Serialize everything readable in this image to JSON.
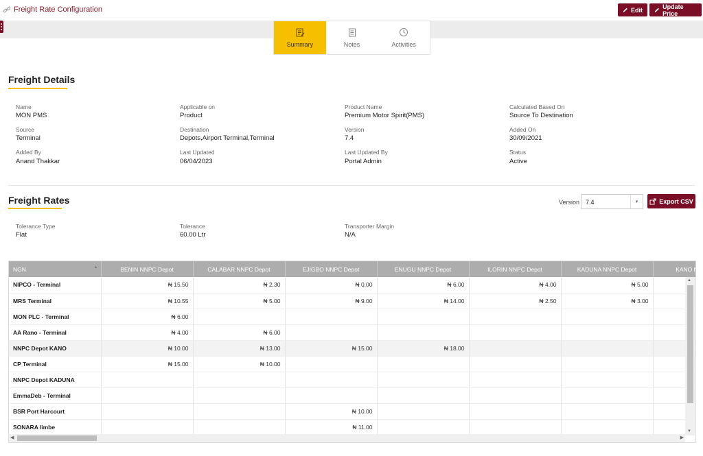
{
  "header": {
    "title": "Freight Rate Configuration",
    "edit_label": "Edit",
    "update_label": "Update Price"
  },
  "tabs": [
    {
      "label": "Summary",
      "icon": "summary-icon",
      "active": true
    },
    {
      "label": "Notes",
      "icon": "notes-icon",
      "active": false
    },
    {
      "label": "Activities",
      "icon": "activities-icon",
      "active": false
    }
  ],
  "freight_details": {
    "title": "Freight Details",
    "fields": [
      {
        "label": "Name",
        "value": "MON PMS"
      },
      {
        "label": "Applicable on",
        "value": "Product"
      },
      {
        "label": "Product Name",
        "value": "Premium Motor Spirit(PMS)"
      },
      {
        "label": "Calculated Based On",
        "value": "Source To Destination"
      },
      {
        "label": "Source",
        "value": "Terminal"
      },
      {
        "label": "Destination",
        "value": "Depots,Airport Terminal,Terminal"
      },
      {
        "label": "Version",
        "value": "7.4"
      },
      {
        "label": "Added On",
        "value": "30/09/2021"
      },
      {
        "label": "Added By",
        "value": "Anand Thakkar"
      },
      {
        "label": "Last Updated",
        "value": "06/04/2023"
      },
      {
        "label": "Last Updated By",
        "value": "Portal Admin"
      },
      {
        "label": "Status",
        "value": "Active"
      }
    ]
  },
  "freight_rates": {
    "title": "Freight Rates",
    "version_label": "Version",
    "version_value": "7.4",
    "export_label": "Export CSV",
    "fields": [
      {
        "label": "Tolerance Type",
        "value": "Flat"
      },
      {
        "label": "Tolerance",
        "value": "60.00 Ltr"
      },
      {
        "label": "Transporter Margin",
        "value": "N/A"
      }
    ]
  },
  "grid": {
    "columns": [
      "NGN",
      "BENIN NNPC Depot",
      "CALABAR NNPC Depot",
      "EJIGBO NNPC Depot",
      "ENUGU NNPC Depot",
      "ILORIN NNPC Depot",
      "KADUNA NNPC Depot",
      "KANO NNPC Depot"
    ],
    "rows": [
      {
        "name": "NIPCO - Terminal",
        "cells": [
          "₦ 15.50",
          "₦ 2.30",
          "₦ 0.00",
          "₦ 6.00",
          "₦ 4.00",
          "₦ 5.00",
          ""
        ]
      },
      {
        "name": "MRS Terminal",
        "cells": [
          "₦ 10.55",
          "₦ 5.00",
          "₦ 9.00",
          "₦ 14.00",
          "₦ 2.50",
          "₦ 3.00",
          ""
        ]
      },
      {
        "name": "MON PLC - Terminal",
        "cells": [
          "₦ 6.00",
          "",
          "",
          "",
          "",
          "",
          ""
        ]
      },
      {
        "name": "AA Rano - Terminal",
        "cells": [
          "₦ 4.00",
          "₦ 6.00",
          "",
          "",
          "",
          "",
          ""
        ]
      },
      {
        "name": "NNPC Depot KANO",
        "cells": [
          "₦ 10.00",
          "₦ 13.00",
          "₦ 15.00",
          "₦ 18.00",
          "",
          "",
          ""
        ],
        "highlight": true
      },
      {
        "name": "CP Terminal",
        "cells": [
          "₦ 15.00",
          "₦ 10.00",
          "",
          "",
          "",
          "",
          ""
        ]
      },
      {
        "name": "NNPC Depot KADUNA",
        "cells": [
          "",
          "",
          "",
          "",
          "",
          "",
          ""
        ]
      },
      {
        "name": "EmmaDeb - Terminal",
        "cells": [
          "",
          "",
          "",
          "",
          "",
          "",
          ""
        ]
      },
      {
        "name": "BSR Port Harcourt",
        "cells": [
          "",
          "",
          "₦ 10.00",
          "",
          "",
          "",
          ""
        ]
      },
      {
        "name": "SONARA limbe",
        "cells": [
          "",
          "",
          "₦ 11.00",
          "",
          "",
          "",
          ""
        ]
      }
    ]
  },
  "colors": {
    "brand": "#7a0e26",
    "accent": "#f6c000",
    "header_gray": "#adadad"
  }
}
